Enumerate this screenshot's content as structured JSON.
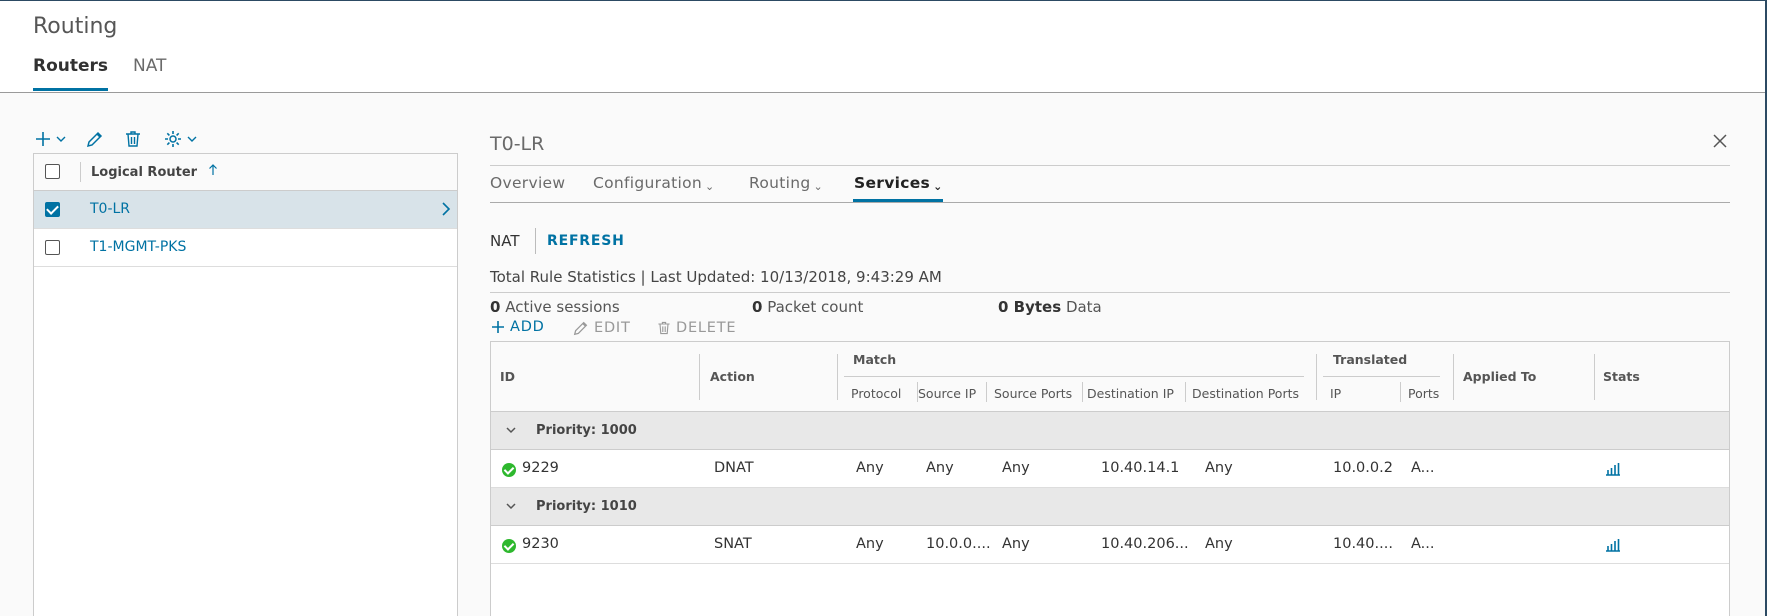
{
  "page": {
    "title": "Routing"
  },
  "main_tabs": [
    {
      "label": "Routers",
      "active": true
    },
    {
      "label": "NAT",
      "active": false
    }
  ],
  "toolbar": {
    "icons": [
      "add-icon",
      "chevron-down-icon",
      "edit-icon",
      "delete-icon",
      "gear-icon",
      "chevron-down-icon"
    ]
  },
  "router_grid": {
    "column_header": "Logical Router",
    "sort_icon": "sort-ascending-icon",
    "rows": [
      {
        "name": "T0-LR",
        "checked": true,
        "selected": true
      },
      {
        "name": "T1-MGMT-PKS",
        "checked": false,
        "selected": false
      }
    ]
  },
  "detail": {
    "title": "T0-LR",
    "tabs": [
      {
        "label": "Overview",
        "dropdown": false,
        "active": false
      },
      {
        "label": "Configuration",
        "dropdown": true,
        "active": false
      },
      {
        "label": "Routing",
        "dropdown": true,
        "active": false
      },
      {
        "label": "Services",
        "dropdown": true,
        "active": true
      }
    ],
    "section_label": "NAT",
    "refresh_label": "REFRESH",
    "stats": {
      "title": "Total Rule Statistics | Last Updated: 10/13/2018, 9:43:29 AM",
      "active_sessions_value": "0",
      "active_sessions_label": "Active sessions",
      "packet_count_value": "0",
      "packet_count_label": "Packet count",
      "bytes_value": "0 Bytes",
      "bytes_label": "Data"
    },
    "actions": {
      "add": "ADD",
      "edit": "EDIT",
      "delete": "DELETE"
    }
  },
  "nat_table": {
    "headers": {
      "id": "ID",
      "action": "Action",
      "match": "Match",
      "protocol": "Protocol",
      "source_ip": "Source IP",
      "source_ports": "Source Ports",
      "destination_ip": "Destination IP",
      "destination_ports": "Destination Ports",
      "translated": "Translated",
      "ip": "IP",
      "ports": "Ports",
      "applied_to": "Applied To",
      "stats": "Stats"
    },
    "groups": [
      {
        "label": "Priority: 1000",
        "rows": [
          {
            "id": "9229",
            "status": "success",
            "action": "DNAT",
            "protocol": "Any",
            "source_ip": "Any",
            "source_ports": "Any",
            "destination_ip": "10.40.14.1",
            "destination_ports": "Any",
            "translated_ip": "10.0.0.2",
            "translated_ports": "A..."
          }
        ]
      },
      {
        "label": "Priority: 1010",
        "rows": [
          {
            "id": "9230",
            "status": "success",
            "action": "SNAT",
            "protocol": "Any",
            "source_ip": "10.0.0....",
            "source_ports": "Any",
            "destination_ip": "10.40.206...",
            "destination_ports": "Any",
            "translated_ip": "10.40....",
            "translated_ports": "A..."
          }
        ]
      }
    ]
  },
  "colors": {
    "accent": "#0072a3",
    "success": "#2eb82e",
    "selected_row": "#d8e3e9"
  }
}
